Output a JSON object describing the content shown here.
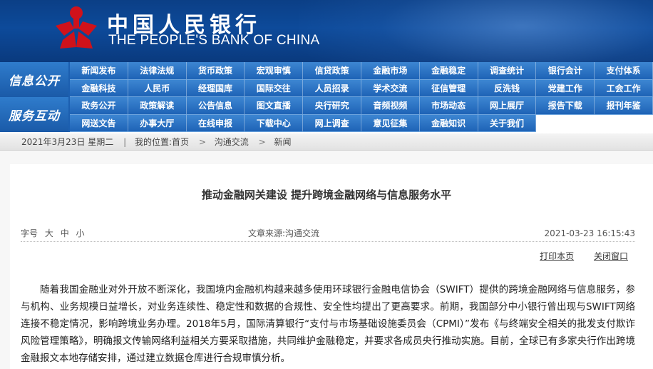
{
  "header": {
    "title_cn": "中国人民银行",
    "title_en": "THE PEOPLE'S BANK OF CHINA",
    "emblem_color": "#d0121b",
    "bg_color": "#0d4a9a"
  },
  "nav": {
    "group1_label": "信息公开",
    "group2_label": "服务互动",
    "rows": [
      [
        "新闻发布",
        "法律法规",
        "货币政策",
        "宏观审慎",
        "信贷政策",
        "金融市场",
        "金融稳定",
        "调查统计",
        "银行会计",
        "支付体系"
      ],
      [
        "金融科技",
        "人民币",
        "经理国库",
        "国际交往",
        "人员招录",
        "学术交流",
        "征信管理",
        "反洗钱",
        "党建工作",
        "工会工作"
      ],
      [
        "政务公开",
        "政策解读",
        "公告信息",
        "图文直播",
        "央行研究",
        "音频视频",
        "市场动态",
        "网上展厅",
        "报告下载",
        "报刊年鉴"
      ],
      [
        "网送文告",
        "办事大厅",
        "在线申报",
        "下载中心",
        "网上调查",
        "意见征集",
        "金融知识",
        "关于我们"
      ]
    ]
  },
  "breadcrumb": {
    "date": "2021年3月23日 星期二",
    "location_label": "我的位置:首页",
    "level1": "沟通交流",
    "level2": "新闻"
  },
  "article": {
    "title": "推动金融网关建设  提升跨境金融网络与信息服务水平",
    "font_size_label": "字号",
    "font_large": "大",
    "font_medium": "中",
    "font_small": "小",
    "source": "文章来源:沟通交流",
    "datetime": "2021-03-23 16:15:43",
    "print_label": "打印本页",
    "close_label": "关闭窗口",
    "body": "随着我国金融业对外开放不断深化，我国境内金融机构越来越多使用环球银行金融电信协会（SWIFT）提供的跨境金融网络与信息服务，参与机构、业务规模日益增长，对业务连续性、稳定性和数据的合规性、安全性均提出了更高要求。前期，我国部分中小银行曾出现与SWIFT网络连接不稳定情况，影响跨境业务办理。2018年5月，国际清算银行“支付与市场基础设施委员会（CPMI）”发布《与终端安全相关的批发支付欺诈风险管理策略》，明确报文传输网络利益相关方要采取措施，共同维护金融稳定，并要求各成员央行推动实施。目前，全球已有多家央行作出跨境金融报文本地存储安排，通过建立数据仓库进行合规审慎分析。"
  }
}
